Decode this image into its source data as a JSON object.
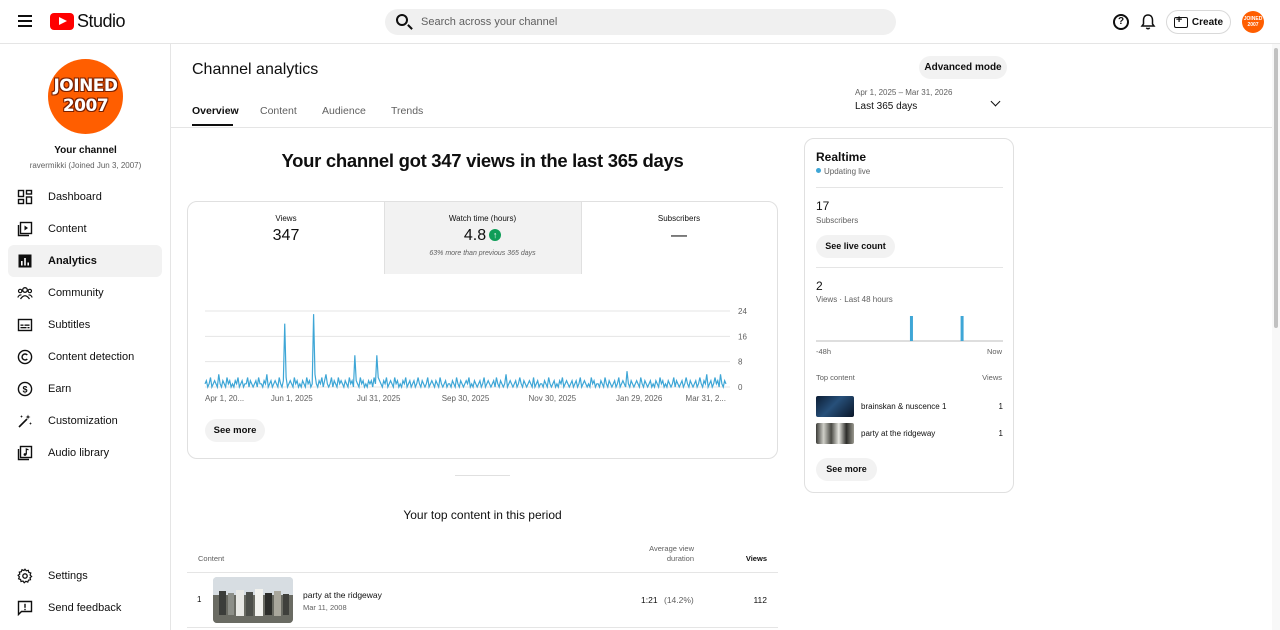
{
  "header": {
    "studio_label": "Studio",
    "search_placeholder": "Search across your channel",
    "create_label": "Create",
    "avatar_text": "JOINED 2007"
  },
  "sidebar": {
    "avatar_text_line1": "JOINED",
    "avatar_text_line2": "2007",
    "channel_title": "Your channel",
    "channel_subtitle": "ravermikki (Joined Jun 3, 2007)",
    "items": [
      {
        "label": "Dashboard",
        "icon": "dashboard-icon"
      },
      {
        "label": "Content",
        "icon": "content-icon"
      },
      {
        "label": "Analytics",
        "icon": "analytics-icon",
        "active": true
      },
      {
        "label": "Community",
        "icon": "community-icon"
      },
      {
        "label": "Subtitles",
        "icon": "subtitles-icon"
      },
      {
        "label": "Content detection",
        "icon": "copyright-icon"
      },
      {
        "label": "Earn",
        "icon": "dollar-icon"
      },
      {
        "label": "Customization",
        "icon": "magic-wand-icon"
      },
      {
        "label": "Audio library",
        "icon": "audio-library-icon"
      }
    ],
    "bottom_items": [
      {
        "label": "Settings",
        "icon": "gear-icon"
      },
      {
        "label": "Send feedback",
        "icon": "feedback-icon"
      }
    ]
  },
  "main": {
    "title": "Channel analytics",
    "advanced_mode_label": "Advanced mode",
    "tabs": [
      {
        "label": "Overview",
        "active": true
      },
      {
        "label": "Content"
      },
      {
        "label": "Audience"
      },
      {
        "label": "Trends"
      }
    ],
    "date_range": "Apr 1, 2025 – Mar 31, 2026",
    "date_period": "Last 365 days",
    "headline": "Your channel got 347 views in the last 365 days",
    "metrics": {
      "views_label": "Views",
      "views_value": "347",
      "watch_label": "Watch time (hours)",
      "watch_value": "4.8",
      "watch_note": "63% more than previous 365 days",
      "subs_label": "Subscribers",
      "subs_value": "—"
    },
    "see_more_label": "See more",
    "top_content": {
      "title": "Your top content in this period",
      "col_content": "Content",
      "col_avg_line1": "Average view",
      "col_avg_line2": "duration",
      "col_views": "Views",
      "rows": [
        {
          "rank": "1",
          "title": "party at the ridgeway",
          "date": "Mar 11, 2008",
          "avg_duration": "1:21",
          "avg_pct": "(14.2%)",
          "views": "112"
        }
      ]
    }
  },
  "realtime": {
    "title": "Realtime",
    "live_label": "Updating live",
    "subscribers_value": "17",
    "subscribers_label": "Subscribers",
    "see_live_label": "See live count",
    "views_value": "2",
    "views_label": "Views · Last 48 hours",
    "axis_start": "-48h",
    "axis_end": "Now",
    "bars": [
      0,
      0,
      0,
      0,
      0,
      0,
      0,
      0,
      0,
      0,
      0,
      0,
      0,
      0,
      0,
      0,
      0,
      0,
      0,
      0,
      0,
      0,
      0,
      0,
      1,
      0,
      0,
      0,
      0,
      0,
      0,
      0,
      0,
      0,
      0,
      0,
      0,
      1,
      0,
      0,
      0,
      0,
      0,
      0,
      0,
      0,
      0,
      0
    ],
    "top_content_label": "Top content",
    "views_column_label": "Views",
    "items": [
      {
        "title": "brainskan & nuscence 1",
        "views": "1"
      },
      {
        "title": "party at the ridgeway",
        "views": "1"
      }
    ],
    "see_more_label": "See more"
  },
  "chart_data": {
    "type": "line",
    "title": "",
    "xlabel": "",
    "ylabel": "",
    "x_tick_labels": [
      "Apr 1, 20...",
      "Jun 1, 2025",
      "Jul 31, 2025",
      "Sep 30, 2025",
      "Nov 30, 2025",
      "Jan 29, 2026",
      "Mar 31, 2..."
    ],
    "y_ticks": [
      0,
      8,
      16,
      24
    ],
    "ylim": [
      0,
      24
    ],
    "grid": true,
    "color": "#3ea6d6",
    "series": [
      {
        "values": [
          1,
          2,
          0,
          1,
          3,
          0,
          1,
          2,
          1,
          0,
          4,
          1,
          0,
          2,
          1,
          0,
          3,
          1,
          2,
          0,
          1,
          0,
          2,
          1,
          3,
          0,
          1,
          2,
          0,
          1,
          1,
          3,
          0,
          2,
          1,
          0,
          1,
          2,
          0,
          3,
          1,
          1,
          0,
          2,
          1,
          4,
          0,
          1,
          2,
          0,
          1,
          2,
          1,
          0,
          3,
          1,
          0,
          2,
          20,
          3,
          0,
          1,
          2,
          1,
          0,
          3,
          1,
          2,
          0,
          1,
          0,
          2,
          1,
          0,
          3,
          1,
          2,
          0,
          1,
          23,
          4,
          1,
          0,
          2,
          1,
          3,
          0,
          2,
          4,
          1,
          0,
          1,
          3,
          0,
          2,
          1,
          0,
          3,
          1,
          2,
          1,
          0,
          2,
          1,
          0,
          3,
          1,
          2,
          0,
          10,
          2,
          1,
          0,
          3,
          1,
          2,
          0,
          1,
          0,
          2,
          1,
          2,
          0,
          3,
          1,
          10,
          3,
          2,
          1,
          0,
          2,
          1,
          3,
          0,
          1,
          2,
          1,
          0,
          3,
          1,
          2,
          0,
          1,
          0,
          2,
          1,
          3,
          0,
          1,
          2,
          0,
          1,
          2,
          0,
          1,
          3,
          1,
          0,
          2,
          1,
          0,
          1,
          3,
          0,
          1,
          2,
          1,
          0,
          2,
          1,
          0,
          3,
          1,
          0,
          1,
          2,
          0,
          1,
          1,
          0,
          2,
          1,
          0,
          3,
          1,
          0,
          2,
          1,
          0,
          1,
          2,
          1,
          3,
          0,
          1,
          0,
          2,
          1,
          0,
          1,
          2,
          0,
          1,
          3,
          0,
          1,
          2,
          1,
          0,
          1,
          2,
          0,
          3,
          1,
          0,
          2,
          1,
          0,
          1,
          4,
          0,
          1,
          2,
          1,
          0,
          1,
          2,
          0,
          1,
          3,
          1,
          0,
          2,
          1,
          0,
          1,
          2,
          1,
          0,
          3,
          0,
          1,
          2,
          0,
          1,
          1,
          0,
          2,
          1,
          0,
          3,
          1,
          0,
          1,
          2,
          0,
          1,
          0,
          2,
          1,
          3,
          0,
          1,
          2,
          1,
          0,
          1,
          2,
          0,
          1,
          2,
          0,
          1,
          3,
          0,
          1,
          2,
          1,
          0,
          1,
          0,
          3,
          1,
          2,
          0,
          1,
          1,
          0,
          2,
          1,
          0,
          3,
          1,
          0,
          2,
          1,
          0,
          1,
          2,
          0,
          1,
          3,
          0,
          1,
          2,
          1,
          0,
          5,
          1,
          0,
          2,
          1,
          0,
          1,
          2,
          1,
          0,
          3,
          1,
          0,
          2,
          1,
          0,
          1,
          2,
          0,
          1,
          0,
          2,
          1,
          0,
          3,
          1,
          2,
          0,
          1,
          0,
          2,
          1,
          0,
          1,
          3,
          0,
          2,
          1,
          0,
          1,
          2,
          0,
          1,
          3,
          1,
          0,
          2,
          1,
          0,
          1,
          2,
          0,
          1,
          3,
          1,
          0,
          2,
          1,
          4,
          0,
          1,
          2,
          0,
          1,
          3,
          1,
          2,
          0,
          4,
          1,
          0,
          2,
          1
        ]
      }
    ]
  }
}
